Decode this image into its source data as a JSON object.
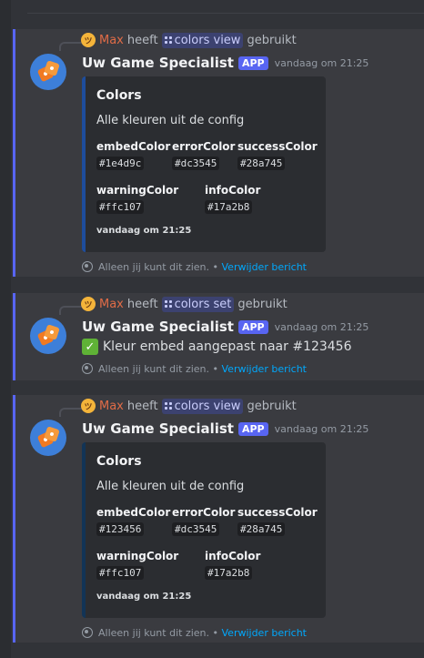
{
  "messages": [
    {
      "reply": {
        "user": "Max",
        "verb": "heeft",
        "command": "colors view",
        "used": "gebruikt"
      },
      "author": "Uw Game Specialist",
      "badge": "APP",
      "time": "vandaag om 21:25",
      "embed": {
        "title": "Colors",
        "description": "Alle kleuren uit de config",
        "accent": "#1e4d9c",
        "fields": [
          {
            "name": "embedColor",
            "value": "#1e4d9c"
          },
          {
            "name": "errorColor",
            "value": "#dc3545"
          },
          {
            "name": "successColor",
            "value": "#28a745"
          },
          {
            "name": "warningColor",
            "value": "#ffc107"
          },
          {
            "name": "infoColor",
            "value": "#17a2b8"
          }
        ],
        "footer": "vandaag om 21:25"
      },
      "ephemeral": {
        "notice": "Alleen jij kunt dit zien. •",
        "dismiss": "Verwijder bericht"
      }
    },
    {
      "reply": {
        "user": "Max",
        "verb": "heeft",
        "command": "colors set",
        "used": "gebruikt"
      },
      "author": "Uw Game Specialist",
      "badge": "APP",
      "time": "vandaag om 21:25",
      "content": "Kleur embed aangepast naar #123456",
      "content_icon": "check-mark-icon",
      "ephemeral": {
        "notice": "Alleen jij kunt dit zien. •",
        "dismiss": "Verwijder bericht"
      }
    },
    {
      "reply": {
        "user": "Max",
        "verb": "heeft",
        "command": "colors view",
        "used": "gebruikt"
      },
      "author": "Uw Game Specialist",
      "badge": "APP",
      "time": "vandaag om 21:25",
      "embed": {
        "title": "Colors",
        "description": "Alle kleuren uit de config",
        "accent": "#123456",
        "fields": [
          {
            "name": "embedColor",
            "value": "#123456"
          },
          {
            "name": "errorColor",
            "value": "#dc3545"
          },
          {
            "name": "successColor",
            "value": "#28a745"
          },
          {
            "name": "warningColor",
            "value": "#ffc107"
          },
          {
            "name": "infoColor",
            "value": "#17a2b8"
          }
        ],
        "footer": "vandaag om 21:25"
      },
      "ephemeral": {
        "notice": "Alleen jij kunt dit zien. •",
        "dismiss": "Verwijder bericht"
      }
    }
  ],
  "colors": {
    "accent": "#5865f2",
    "link": "#00a8fc",
    "username": "#e06c47",
    "background": "#313338"
  }
}
